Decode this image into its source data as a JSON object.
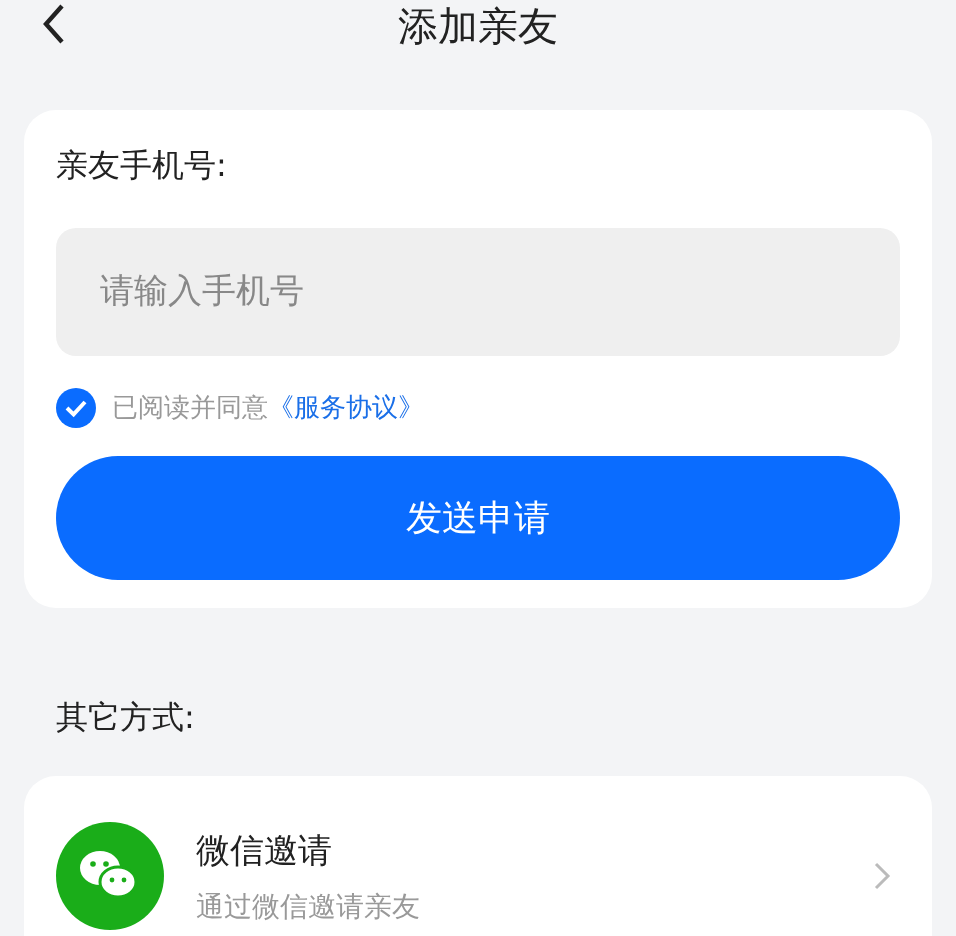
{
  "header": {
    "title": "添加亲友"
  },
  "form": {
    "label": "亲友手机号:",
    "phone": {
      "placeholder": "请输入手机号"
    },
    "agreement": {
      "checked": true,
      "text": "已阅读并同意",
      "link": "《服务协议》"
    },
    "submit": "发送申请"
  },
  "other": {
    "heading": "其它方式:",
    "items": [
      {
        "kind": "wechat",
        "title": "微信邀请",
        "subtitle": "通过微信邀请亲友"
      }
    ]
  }
}
